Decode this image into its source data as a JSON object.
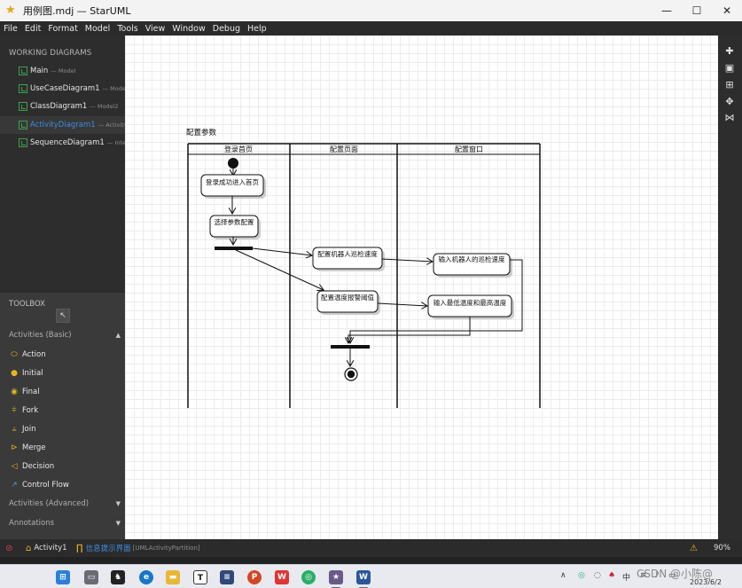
{
  "window": {
    "title": "用例图.mdj — StarUML",
    "minimize": "—",
    "maximize": "☐",
    "close": "✕"
  },
  "menu": [
    "File",
    "Edit",
    "Format",
    "Model",
    "Tools",
    "View",
    "Window",
    "Debug",
    "Help"
  ],
  "working_diagrams": {
    "title": "WORKING DIAGRAMS",
    "items": [
      {
        "name": "Main",
        "sub": "— Model"
      },
      {
        "name": "UseCaseDiagram1",
        "sub": "— Model1"
      },
      {
        "name": "ClassDiagram1",
        "sub": "— Model2"
      },
      {
        "name": "ActivityDiagram1",
        "sub": "— Activity1"
      },
      {
        "name": "SequenceDiagram1",
        "sub": "— Interact"
      }
    ]
  },
  "toolbox": {
    "title": "TOOLBOX",
    "sections": {
      "basic": "Activities (Basic)",
      "advanced": "Activities (Advanced)",
      "annotations": "Annotations"
    },
    "items": [
      "Action",
      "Initial",
      "Final",
      "Fork",
      "Join",
      "Merge",
      "Decision",
      "Control Flow"
    ]
  },
  "diagram": {
    "frame_title": "配置参数",
    "lanes": [
      "登录首页",
      "配置页面",
      "配置窗口"
    ],
    "actions": {
      "a1": "登录成功进入首页",
      "a2": "选择参数配置",
      "a3": "配置机器人巡检速度",
      "a4": "配置温度报警阈值",
      "a5": "输入机器人的巡检速度",
      "a6": "输入最低温度和最高温度"
    }
  },
  "statusbar": {
    "diagram": "Activity1",
    "element": "信息提示界面",
    "element_type": "[UMLActivityPartition]",
    "zoom": "90%"
  },
  "taskbar": {
    "ime": "中",
    "date": "2023/6/2"
  },
  "watermark": "CSDN @小陈@"
}
